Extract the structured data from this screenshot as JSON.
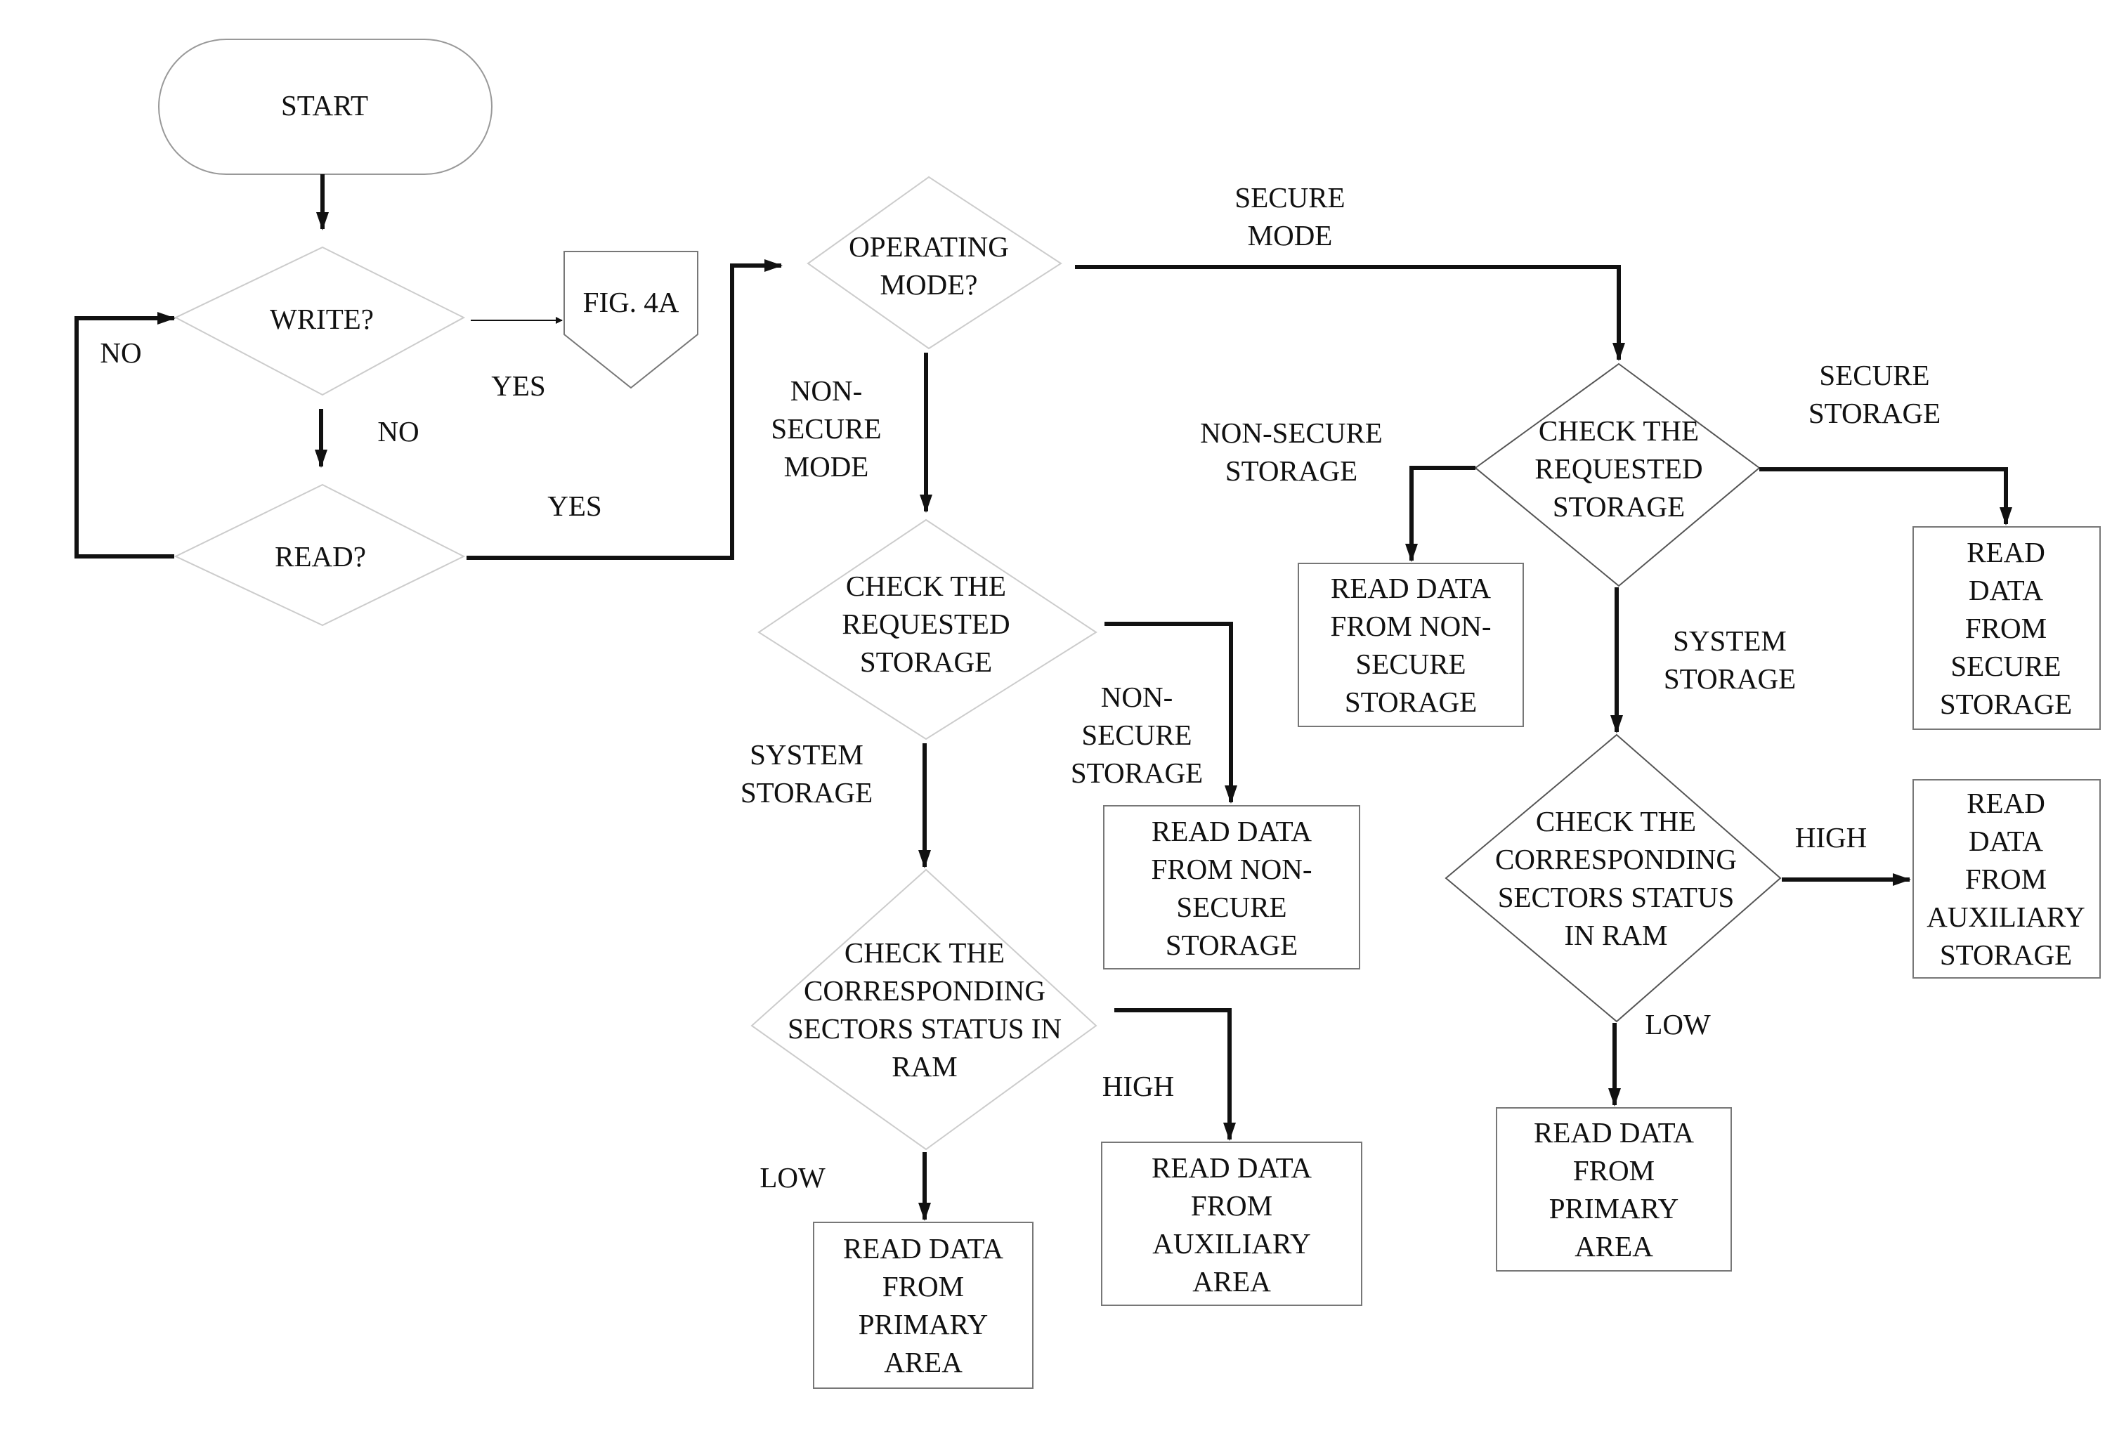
{
  "figure": {
    "nodes": {
      "start": "START",
      "write": "WRITE?",
      "fig4a": "FIG. 4A",
      "read": "READ?",
      "opmode": "OPERATING\nMODE?",
      "ns_check": "CHECK THE\nREQUESTED\nSTORAGE",
      "ns_read_nonsecure": "READ DATA\nFROM NON-\nSECURE\nSTORAGE",
      "ns_check_ram": "CHECK THE\nCORRESPONDING\nSECTORS STATUS IN\nRAM",
      "ns_read_aux": "READ DATA\nFROM\nAUXILIARY\nAREA",
      "ns_read_primary": "READ DATA\nFROM\nPRIMARY\nAREA",
      "s_check": "CHECK THE\nREQUESTED\nSTORAGE",
      "s_read_nonsecure": "READ DATA\nFROM NON-\nSECURE\nSTORAGE",
      "s_read_secure": "READ\nDATA\nFROM\nSECURE\nSTORAGE",
      "s_check_ram": "CHECK THE\nCORRESPONDING\nSECTORS STATUS\nIN RAM",
      "s_read_aux": "READ\nDATA\nFROM\nAUXILIARY\nSTORAGE",
      "s_read_primary": "READ DATA\nFROM\nPRIMARY\nAREA"
    },
    "labels": {
      "write_no": "NO",
      "write_yes": "YES",
      "read_no": "NO",
      "read_yes": "YES",
      "secure_mode": "SECURE\nMODE",
      "non_secure_mode": "NON-\nSECURE\nMODE",
      "ns_system_storage": "SYSTEM\nSTORAGE",
      "ns_non_secure_storage": "NON-\nSECURE\nSTORAGE",
      "ns_high": "HIGH",
      "ns_low": "LOW",
      "s_non_secure_storage": "NON-SECURE\nSTORAGE",
      "s_secure_storage": "SECURE\nSTORAGE",
      "s_system_storage": "SYSTEM\nSTORAGE",
      "s_high": "HIGH",
      "s_low": "LOW"
    }
  }
}
